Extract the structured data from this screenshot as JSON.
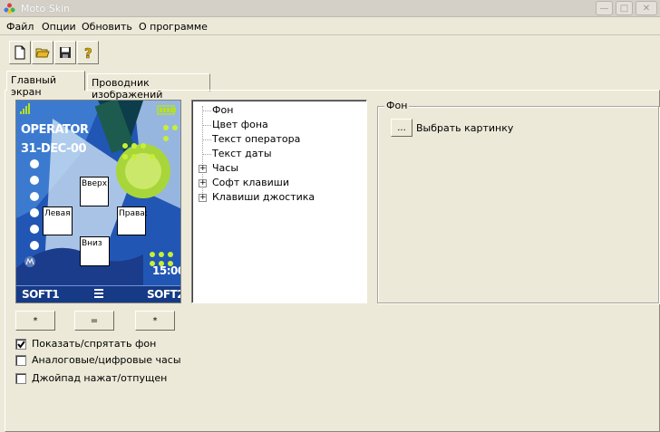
{
  "window": {
    "title": "Moto Skin",
    "min_glyph": "—",
    "max_glyph": "□",
    "close_glyph": "✕"
  },
  "menu": {
    "items": [
      {
        "label": "Файл"
      },
      {
        "label": "Опции"
      },
      {
        "label": "Обновить"
      },
      {
        "label": "О программе"
      }
    ]
  },
  "toolbar": {
    "buttons": [
      {
        "icon": "new-file-icon"
      },
      {
        "icon": "open-folder-icon"
      },
      {
        "icon": "save-disk-icon"
      },
      {
        "icon": "help-icon"
      }
    ]
  },
  "tabs": [
    {
      "label": "Главный экран",
      "active": true
    },
    {
      "label": "Проводник изображений",
      "active": false
    }
  ],
  "phone": {
    "operator": "OPERATOR",
    "date": "31-DEC-00",
    "time": "15:00",
    "soft1": "SOFT1",
    "soft2": "SOFT2",
    "zones": {
      "up": "Вверх",
      "left": "Левая",
      "right": "Права:",
      "down": "Вниз"
    },
    "colors": {
      "screen_bg": "#1a3f8c",
      "accent_green": "#b6e21f",
      "softbar": "#163a86"
    }
  },
  "softkey_buttons": [
    {
      "label": "*"
    },
    {
      "label": "="
    },
    {
      "label": "*"
    }
  ],
  "tree": {
    "items": [
      {
        "label": "Фон",
        "expandable": false
      },
      {
        "label": "Цвет фона",
        "expandable": false
      },
      {
        "label": "Текст оператора",
        "expandable": false
      },
      {
        "label": "Текст даты",
        "expandable": false
      },
      {
        "label": "Часы",
        "expandable": true
      },
      {
        "label": "Софт клавиши",
        "expandable": true
      },
      {
        "label": "Клавиши джостика",
        "expandable": true
      }
    ],
    "expander_glyph": "+"
  },
  "properties": {
    "group_title": "Фон",
    "browse_button": "...",
    "browse_label": "Выбрать картинку"
  },
  "options": [
    {
      "label": "Показать/спрятать фон",
      "checked": true
    },
    {
      "label": "Аналоговые/цифровые часы",
      "checked": false
    },
    {
      "label": "Джойпад нажат/отпущен",
      "checked": false
    }
  ]
}
